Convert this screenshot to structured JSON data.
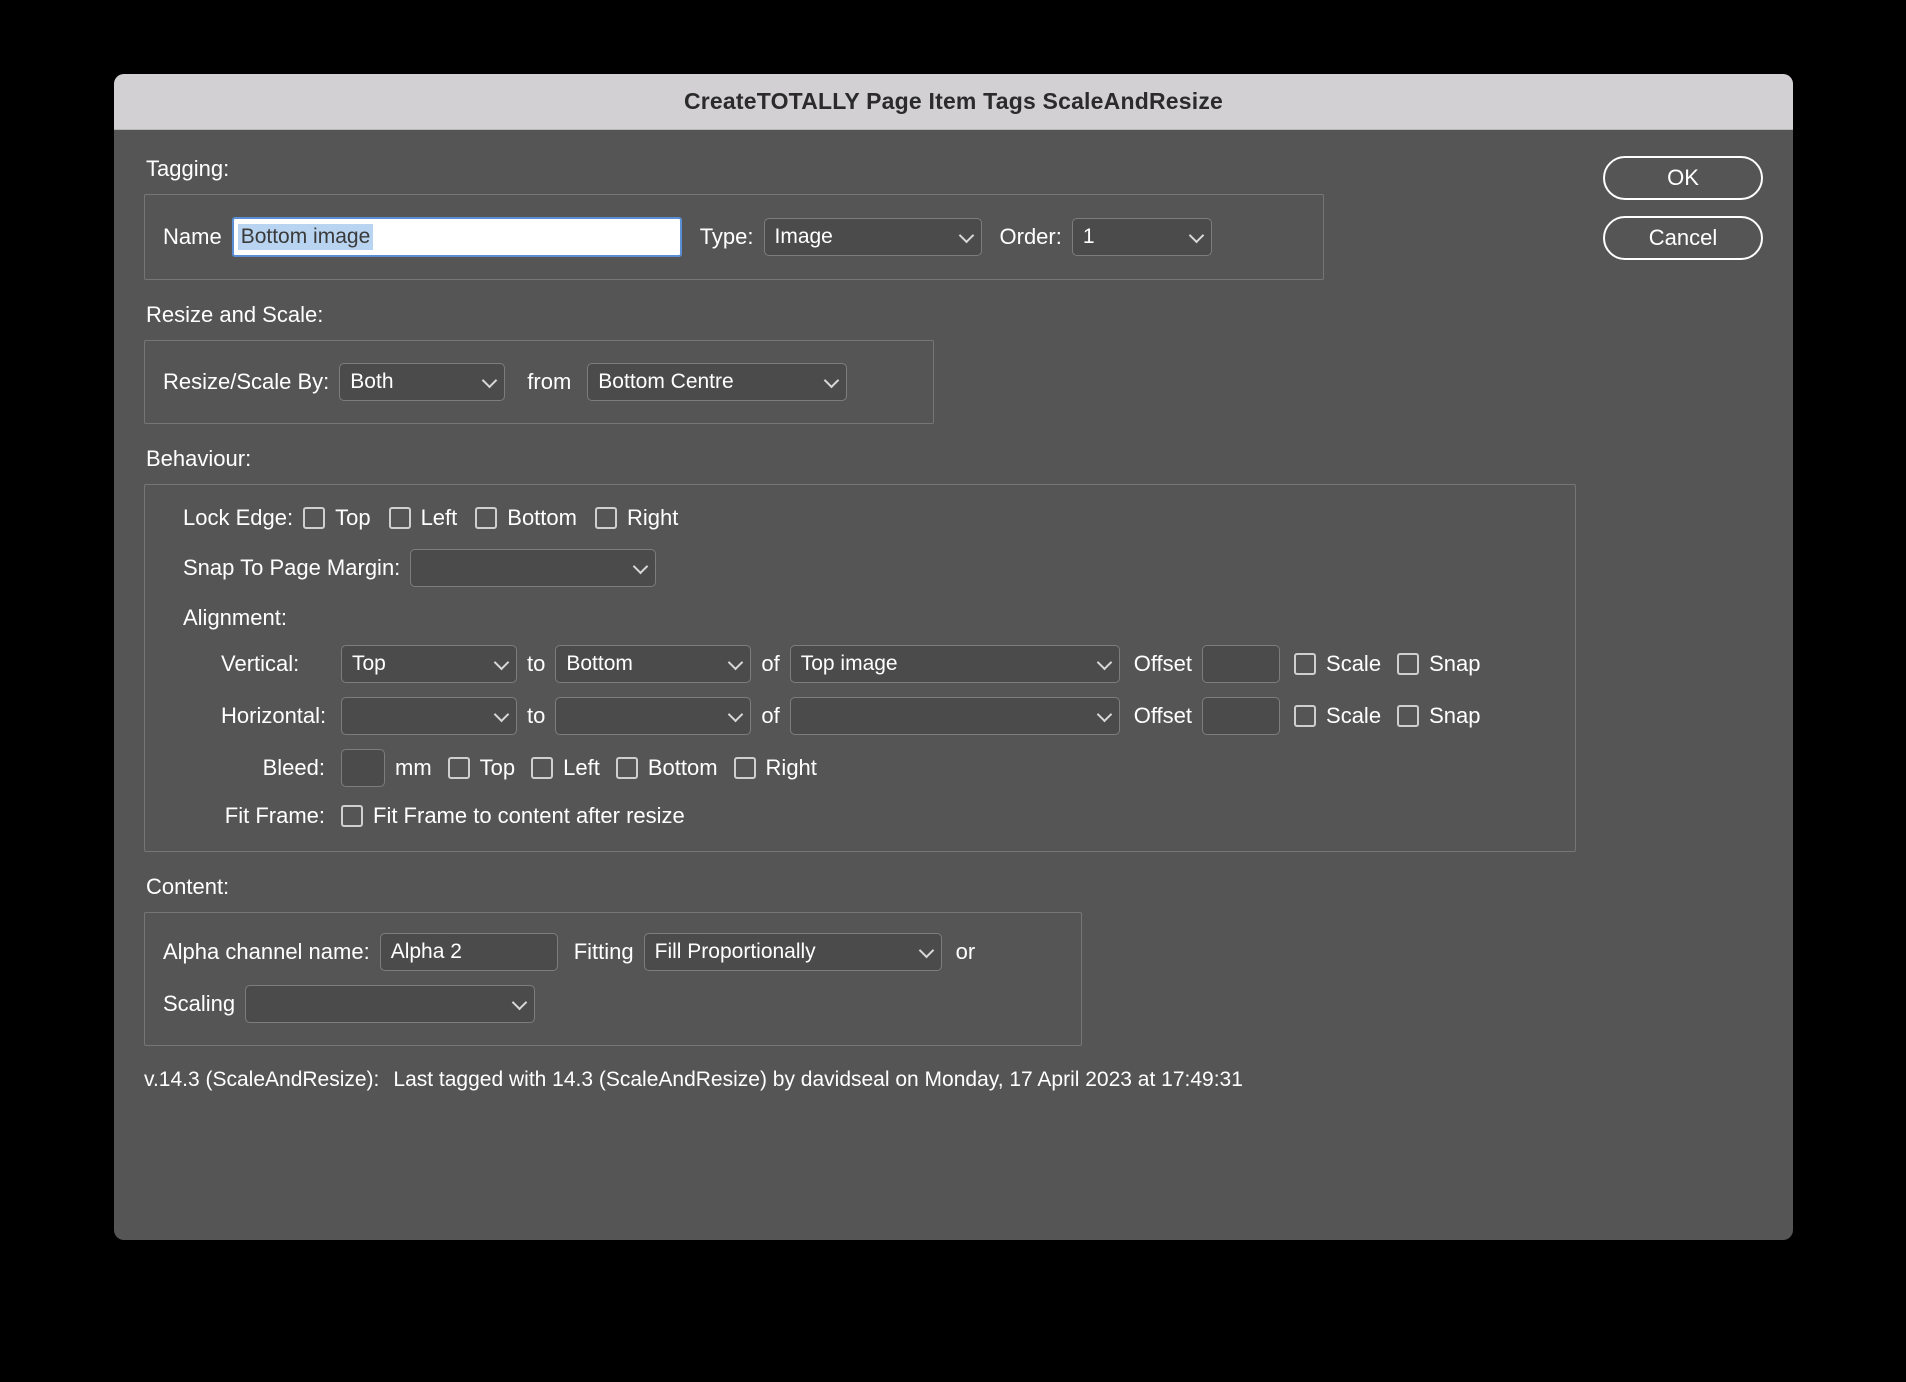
{
  "window": {
    "title": "CreateTOTALLY Page Item Tags ScaleAndResize"
  },
  "buttons": {
    "ok": "OK",
    "cancel": "Cancel"
  },
  "tagging": {
    "heading": "Tagging:",
    "name_label": "Name",
    "name_value": "Bottom image",
    "name_placeholder": "",
    "type_label": "Type:",
    "type_value": "Image",
    "order_label": "Order:",
    "order_value": "1"
  },
  "resize_and_scale": {
    "heading": "Resize and Scale:",
    "by_label": "Resize/Scale By:",
    "by_value": "Both",
    "from_label": "from",
    "from_value": "Bottom Centre"
  },
  "behaviour": {
    "heading": "Behaviour:",
    "lock_edge_label": "Lock Edge:",
    "lock_edges": [
      {
        "label": "Top",
        "checked": false
      },
      {
        "label": "Left",
        "checked": false
      },
      {
        "label": "Bottom",
        "checked": false
      },
      {
        "label": "Right",
        "checked": false
      }
    ],
    "snap_margin_label": "Snap To Page Margin:",
    "snap_margin_value": "",
    "alignment_label": "Alignment:",
    "vertical": {
      "label": "Vertical:",
      "from_value": "Top",
      "to_label": "to",
      "to_value": "Bottom",
      "of_label": "of",
      "of_value": "Top image",
      "offset_label": "Offset",
      "offset_value": "",
      "scale_label": "Scale",
      "scale_checked": false,
      "snap_label": "Snap",
      "snap_checked": false
    },
    "horizontal": {
      "label": "Horizontal:",
      "from_value": "",
      "to_label": "to",
      "to_value": "",
      "of_label": "of",
      "of_value": "",
      "offset_label": "Offset",
      "offset_value": "",
      "scale_label": "Scale",
      "scale_checked": false,
      "snap_label": "Snap",
      "snap_checked": false
    },
    "bleed": {
      "label": "Bleed:",
      "value": "",
      "unit": "mm",
      "edges": [
        {
          "label": "Top",
          "checked": false
        },
        {
          "label": "Left",
          "checked": false
        },
        {
          "label": "Bottom",
          "checked": false
        },
        {
          "label": "Right",
          "checked": false
        }
      ]
    },
    "fit_frame": {
      "label": "Fit Frame:",
      "checkbox_label": "Fit Frame to content after resize",
      "checked": false
    }
  },
  "content": {
    "heading": "Content:",
    "alpha_label": "Alpha channel name:",
    "alpha_value": "Alpha 2",
    "fitting_label": "Fitting",
    "fitting_value": "Fill Proportionally",
    "or_label": "or",
    "scaling_label": "Scaling",
    "scaling_value": ""
  },
  "status": {
    "version": "v.14.3 (ScaleAndResize):",
    "last_tagged": "Last tagged with 14.3 (ScaleAndResize) by davidseal  on Monday, 17 April 2023 at 17:49:31"
  },
  "colors": {
    "dialog_bg": "#555555",
    "titlebar_bg": "#d3d0d4",
    "control_bg": "#4b4b4b",
    "control_border": "#7d7d7d",
    "focus_border": "#5a8fd6",
    "selection_bg": "#b9d4f0",
    "text": "#ffffff"
  }
}
